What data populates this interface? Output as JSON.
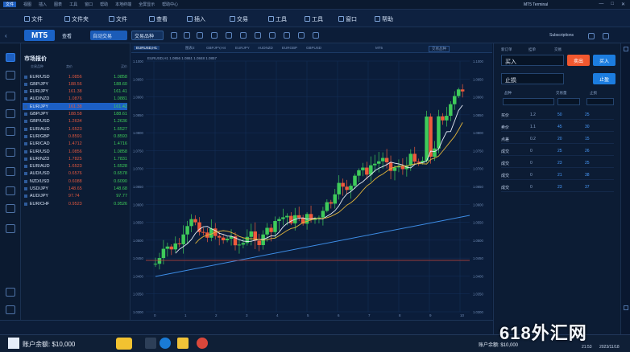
{
  "topbar": {
    "menu": [
      "文件",
      "视图",
      "插入",
      "图表",
      "工具",
      "窗口",
      "帮助",
      "本地终端",
      "全屏显示",
      "帮助中心"
    ],
    "title": "MT5 Terminal",
    "controls": [
      "—",
      "□",
      "✕"
    ]
  },
  "menubar": {
    "items": [
      "文件",
      "文件夹",
      "文件",
      "查看",
      "插入",
      "交易",
      "工具",
      "工具",
      "窗口",
      "帮助"
    ]
  },
  "toolbar": {
    "logo": "MT5",
    "view_btn": "查看",
    "blue_btn": "自动交易",
    "outline_btn": "交易品种",
    "right_label": "Subscriptions"
  },
  "market": {
    "title": "市场报价",
    "cols": [
      "交易品种",
      "卖价",
      "买价"
    ],
    "rows": [
      {
        "sym": "EUR/USD",
        "bid": "1.0856",
        "ask": "1.0858"
      },
      {
        "sym": "GBP/JPY",
        "bid": "188.56",
        "ask": "188.60"
      },
      {
        "sym": "EUR/JPY",
        "bid": "161.38",
        "ask": "161.41"
      },
      {
        "sym": "AUD/NZD",
        "bid": "1.0876",
        "ask": "1.0881"
      },
      {
        "sym": "EUR/JPY",
        "bid": "161.38",
        "ask": "161.42"
      },
      {
        "sym": "GBP/JPY",
        "bid": "188.58",
        "ask": "188.61"
      },
      {
        "sym": "GBP/USD",
        "bid": "1.2634",
        "ask": "1.2636"
      },
      {
        "sym": "EUR/AUD",
        "bid": "1.6523",
        "ask": "1.6527"
      },
      {
        "sym": "EUR/GBP",
        "bid": "0.8591",
        "ask": "0.8593"
      },
      {
        "sym": "EUR/CAD",
        "bid": "1.4712",
        "ask": "1.4716"
      },
      {
        "sym": "EUR/USD",
        "bid": "1.0856",
        "ask": "1.0858"
      },
      {
        "sym": "EUR/NZD",
        "bid": "1.7825",
        "ask": "1.7831"
      },
      {
        "sym": "EUR/AUD",
        "bid": "1.6523",
        "ask": "1.6528"
      },
      {
        "sym": "AUD/USD",
        "bid": "0.6576",
        "ask": "0.6578"
      },
      {
        "sym": "NZD/USD",
        "bid": "0.6088",
        "ask": "0.6090"
      },
      {
        "sym": "USD/JPY",
        "bid": "148.65",
        "ask": "148.68"
      },
      {
        "sym": "AUD/JPY",
        "bid": "97.74",
        "ask": "97.77"
      },
      {
        "sym": "EUR/CHF",
        "bid": "0.9523",
        "ask": "0.9526"
      }
    ],
    "selected": 4
  },
  "chart": {
    "tabs": [
      "EURUSD,H1",
      "图表2",
      "GBPJPY,H4",
      "EURJPY",
      "AUDNZD",
      "EURGBP",
      "GBPUSD"
    ],
    "info": "EURUSD,H1  1.0856  1.0861  1.0848  1.0857",
    "right_tab": "交易品种",
    "tab_mid": "MT5",
    "yticks": [
      "1.1000",
      "1.0950",
      "1.0900",
      "1.0850",
      "1.0800",
      "1.0750",
      "1.0700",
      "1.0650",
      "1.0600",
      "1.0550",
      "1.0500",
      "1.0450",
      "1.0400",
      "1.0350",
      "1.0300"
    ],
    "xticks": [
      "0",
      "1",
      "2",
      "3",
      "4",
      "5",
      "6",
      "7",
      "8",
      "9",
      "10"
    ]
  },
  "orderpanel": {
    "tabs": [
      "新订单",
      "挂单",
      "交易"
    ],
    "buy_label": "买入",
    "sell_btn": "卖出",
    "buy_btn": "买入",
    "stop_label": "止损",
    "stop_btn": "止盈",
    "small": [
      "品种",
      "交易量",
      "止损"
    ],
    "book": [
      {
        "a": "买价",
        "b": "1.2",
        "c": "50",
        "d": "25"
      },
      {
        "a": "卖价",
        "b": "1.1",
        "c": "45",
        "d": "30"
      },
      {
        "a": "点差",
        "b": "0.2",
        "c": "20",
        "d": "15"
      },
      {
        "a": "成交",
        "b": "0",
        "c": "25",
        "d": "26"
      },
      {
        "a": "成交",
        "b": "0",
        "c": "23",
        "d": "25"
      },
      {
        "a": "成交",
        "b": "0",
        "c": "21",
        "d": "38"
      },
      {
        "a": "成交",
        "b": "0",
        "c": "23",
        "d": "37"
      }
    ]
  },
  "status": {
    "left": "账户余额: $10,000",
    "right": "账户余额: $10,000",
    "time": "21:53",
    "date": "2023/11/18"
  },
  "watermark": "618外汇网",
  "colors": {
    "up": "#3ecb5a",
    "down": "#ef5a3c",
    "accent": "#1d5fc0",
    "sell": "#f2582f",
    "buy": "#1c7de0"
  }
}
